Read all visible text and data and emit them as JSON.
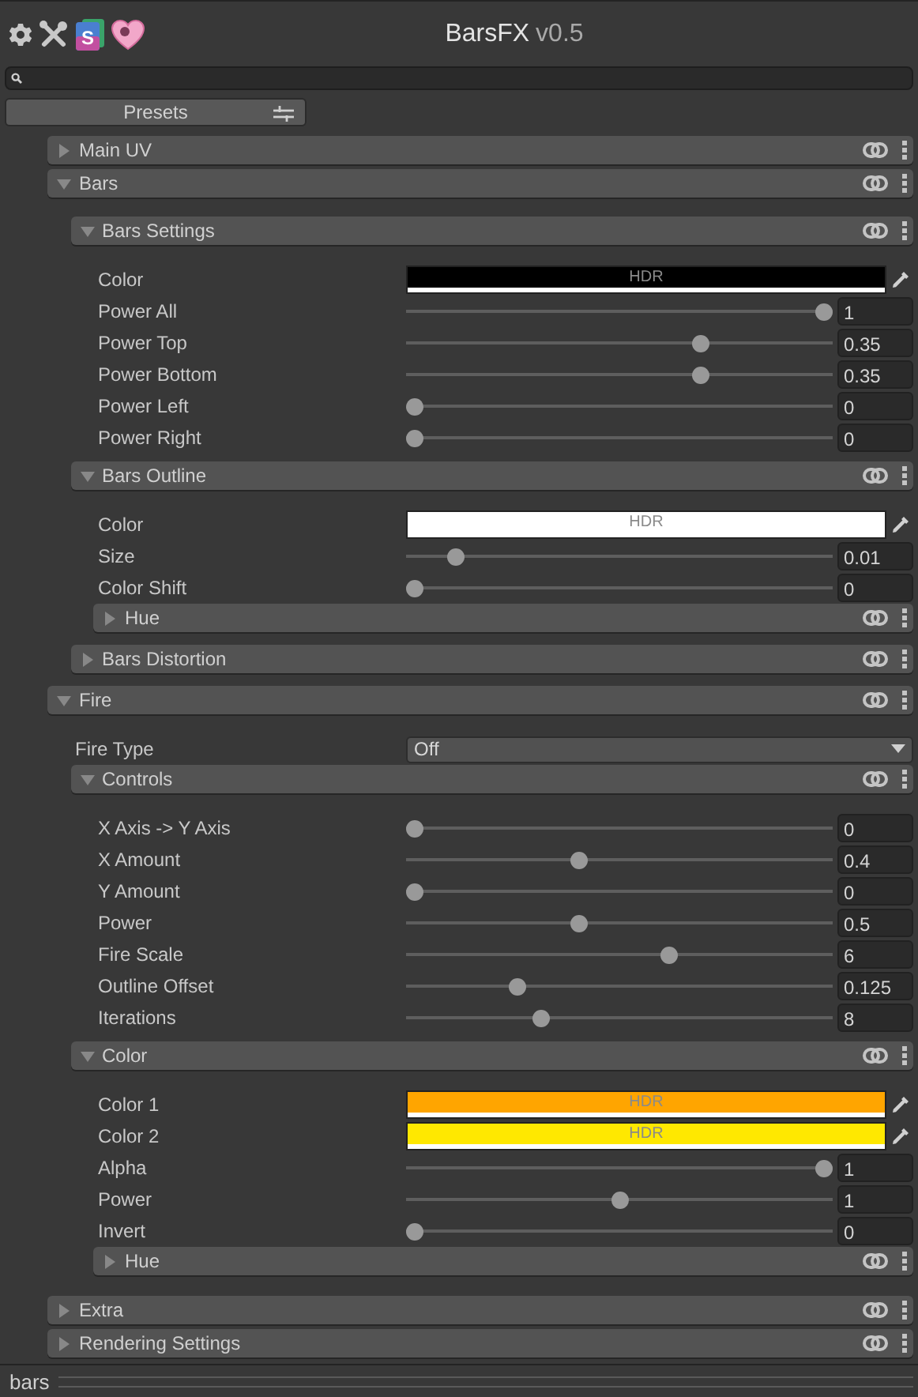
{
  "toolbar": {
    "title": "BarsFX",
    "version": "v0.5",
    "logo_letter": "S"
  },
  "presets_button": "Presets",
  "sections": [
    {
      "kind": "section",
      "title": "Main UV",
      "expanded": false
    },
    {
      "kind": "section",
      "title": "Bars",
      "expanded": true,
      "children": [
        {
          "kind": "section",
          "title": "Bars Settings",
          "expanded": true,
          "children": [
            {
              "kind": "color",
              "label": "Color",
              "color": "#000000",
              "hdr": "HDR"
            },
            {
              "kind": "slider",
              "label": "Power All",
              "level": 1,
              "value": "1"
            },
            {
              "kind": "slider",
              "label": "Power Top",
              "level": 0.7,
              "value": "0.35"
            },
            {
              "kind": "slider",
              "label": "Power Bottom",
              "level": 0.7,
              "value": "0.35"
            },
            {
              "kind": "slider",
              "label": "Power Left",
              "level": 0,
              "value": "0"
            },
            {
              "kind": "slider",
              "label": "Power Right",
              "level": 0,
              "value": "0"
            }
          ]
        },
        {
          "kind": "section",
          "title": "Bars Outline",
          "expanded": true,
          "children": [
            {
              "kind": "color",
              "label": "Color",
              "color": "#ffffff",
              "hdr": "HDR"
            },
            {
              "kind": "slider",
              "label": "Size",
              "level": 0.1,
              "value": "0.01"
            },
            {
              "kind": "slider",
              "label": "Color Shift",
              "level": 0,
              "value": "0"
            },
            {
              "kind": "section",
              "title": "Hue",
              "expanded": false
            }
          ]
        },
        {
          "kind": "section",
          "title": "Bars Distortion",
          "expanded": false
        }
      ]
    },
    {
      "kind": "section",
      "title": "Fire",
      "expanded": true,
      "children": [
        {
          "kind": "dropdown",
          "label": "Fire Type",
          "value": "Off"
        },
        {
          "kind": "section",
          "title": "Controls",
          "expanded": true,
          "children": [
            {
              "kind": "slider",
              "label": "X Axis -> Y Axis",
              "level": 0,
              "value": "0"
            },
            {
              "kind": "slider",
              "label": "X Amount",
              "level": 0.4,
              "value": "0.4"
            },
            {
              "kind": "slider",
              "label": "Y Amount",
              "level": 0,
              "value": "0"
            },
            {
              "kind": "slider",
              "label": "Power",
              "level": 0.4,
              "value": "0.5"
            },
            {
              "kind": "slider",
              "label": "Fire Scale",
              "level": 0.62,
              "value": "6"
            },
            {
              "kind": "slider",
              "label": "Outline Offset",
              "level": 0.25,
              "value": "0.125"
            },
            {
              "kind": "slider",
              "label": "Iterations",
              "level": 0.31,
              "value": "8"
            }
          ]
        },
        {
          "kind": "section",
          "title": "Color",
          "expanded": true,
          "children": [
            {
              "kind": "color",
              "label": "Color 1",
              "color": "#ffa500",
              "hdr": "HDR"
            },
            {
              "kind": "color",
              "label": "Color 2",
              "color": "#ffe800",
              "hdr": "HDR"
            },
            {
              "kind": "slider",
              "label": "Alpha",
              "level": 1,
              "value": "1"
            },
            {
              "kind": "slider",
              "label": "Power",
              "level": 0.5,
              "value": "1"
            },
            {
              "kind": "slider",
              "label": "Invert",
              "level": 0,
              "value": "0"
            },
            {
              "kind": "section",
              "title": "Hue",
              "expanded": false
            }
          ]
        }
      ]
    },
    {
      "kind": "section",
      "title": "Extra",
      "expanded": false
    },
    {
      "kind": "section",
      "title": "Rendering Settings",
      "expanded": false
    }
  ],
  "status_bar": {
    "text": "bars"
  }
}
